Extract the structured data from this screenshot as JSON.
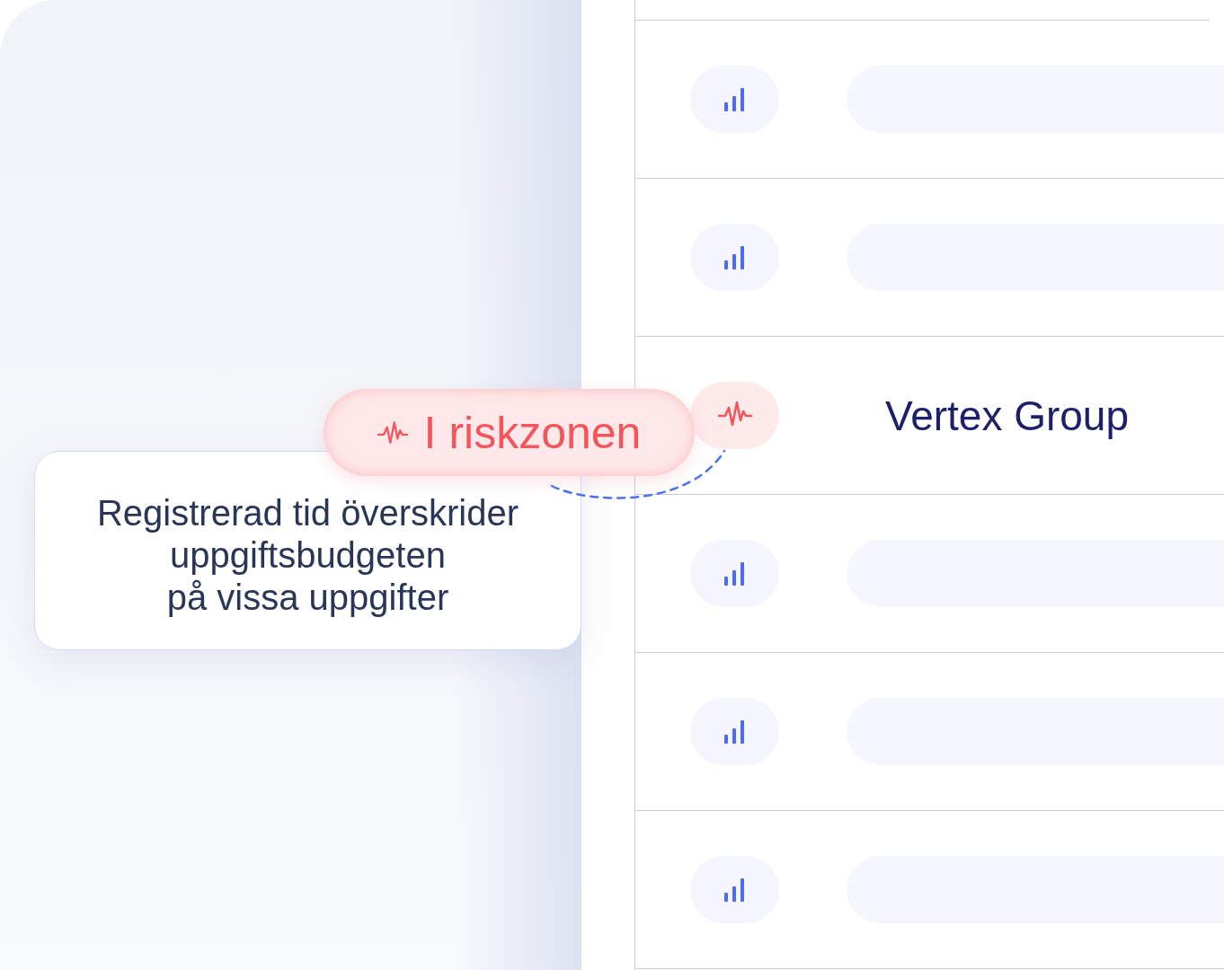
{
  "rows": [
    {
      "kind": "normal"
    },
    {
      "kind": "normal"
    },
    {
      "kind": "risk",
      "name": "Vertex Group"
    },
    {
      "kind": "normal"
    },
    {
      "kind": "normal"
    },
    {
      "kind": "normal"
    }
  ],
  "badge": {
    "label": "I riskzonen"
  },
  "callout": {
    "text": "Registrerad tid överskrider\nuppgiftsbudgeten\npå vissa uppgifter"
  }
}
